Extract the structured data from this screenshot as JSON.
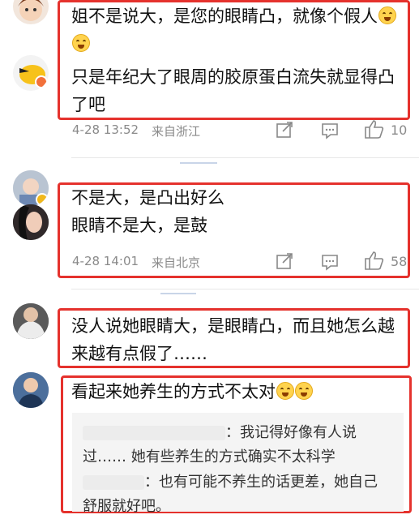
{
  "comments": [
    {
      "lines": [
        "姐不是说大，是您的眼睛凸，就像个假人",
        "只是年纪大了眼周的胶原蛋白流失就显得凸",
        "了吧"
      ],
      "date": "4-28 13:52",
      "location": "来自浙江",
      "likes": "10"
    },
    {
      "lines": [
        "不是大，是凸出好么",
        "眼睛不是大，是鼓"
      ],
      "date": "4-28 14:01",
      "location": "来自北京",
      "likes": "58"
    },
    {
      "lines": [
        "没人说她眼睛大，是眼睛凸，而且她怎么越",
        "来越有点假了……"
      ]
    },
    {
      "lines": [
        "看起来她养生的方式不太对"
      ],
      "replies": [
        {
          "text_1": "：我记得好像有人说",
          "text_2": "过…… 她有些养生的方式确实不太科学"
        },
        {
          "text_1": "：也有可能不养生的话更差，她自己",
          "text_2": "舒服就好吧。"
        }
      ]
    }
  ],
  "icons": [
    "share-icon",
    "comment-icon",
    "like-icon"
  ],
  "colors": {
    "highlight_border": "#e5322d",
    "meta_text": "#8a8a8a",
    "reply_bg": "#f4f4f4"
  }
}
